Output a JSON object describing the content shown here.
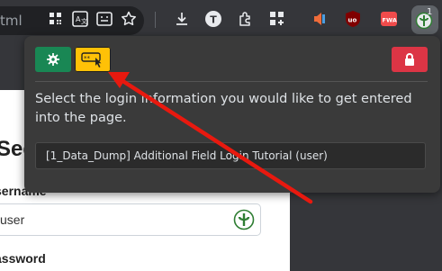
{
  "browser": {
    "url_fragment": "tml",
    "extension_badge": "1",
    "toolbar_icons": [
      "apps-grid-icon",
      "translate-icon",
      "screen-capture-icon",
      "bookmark-star-icon",
      "download-icon",
      "profile-t-icon",
      "extensions-puzzle-icon",
      "add-extension-icon",
      "pocket-speaker-icon",
      "ublock-icon",
      "fwa-icon",
      "keepass-ext-icon"
    ]
  },
  "page": {
    "heading": "Sec",
    "username_label": "sername",
    "username_value": "user",
    "password_label": "assword"
  },
  "popup": {
    "message": "Select the login information you would like to get entered into the page.",
    "login_entries": [
      "[1_Data_Dump] Additional Field Login Tutorial (user)"
    ],
    "colors": {
      "settings": "#198754",
      "autofill": "#ffc107",
      "lock": "#dc3545",
      "annotation_arrow": "#e8190f"
    }
  }
}
